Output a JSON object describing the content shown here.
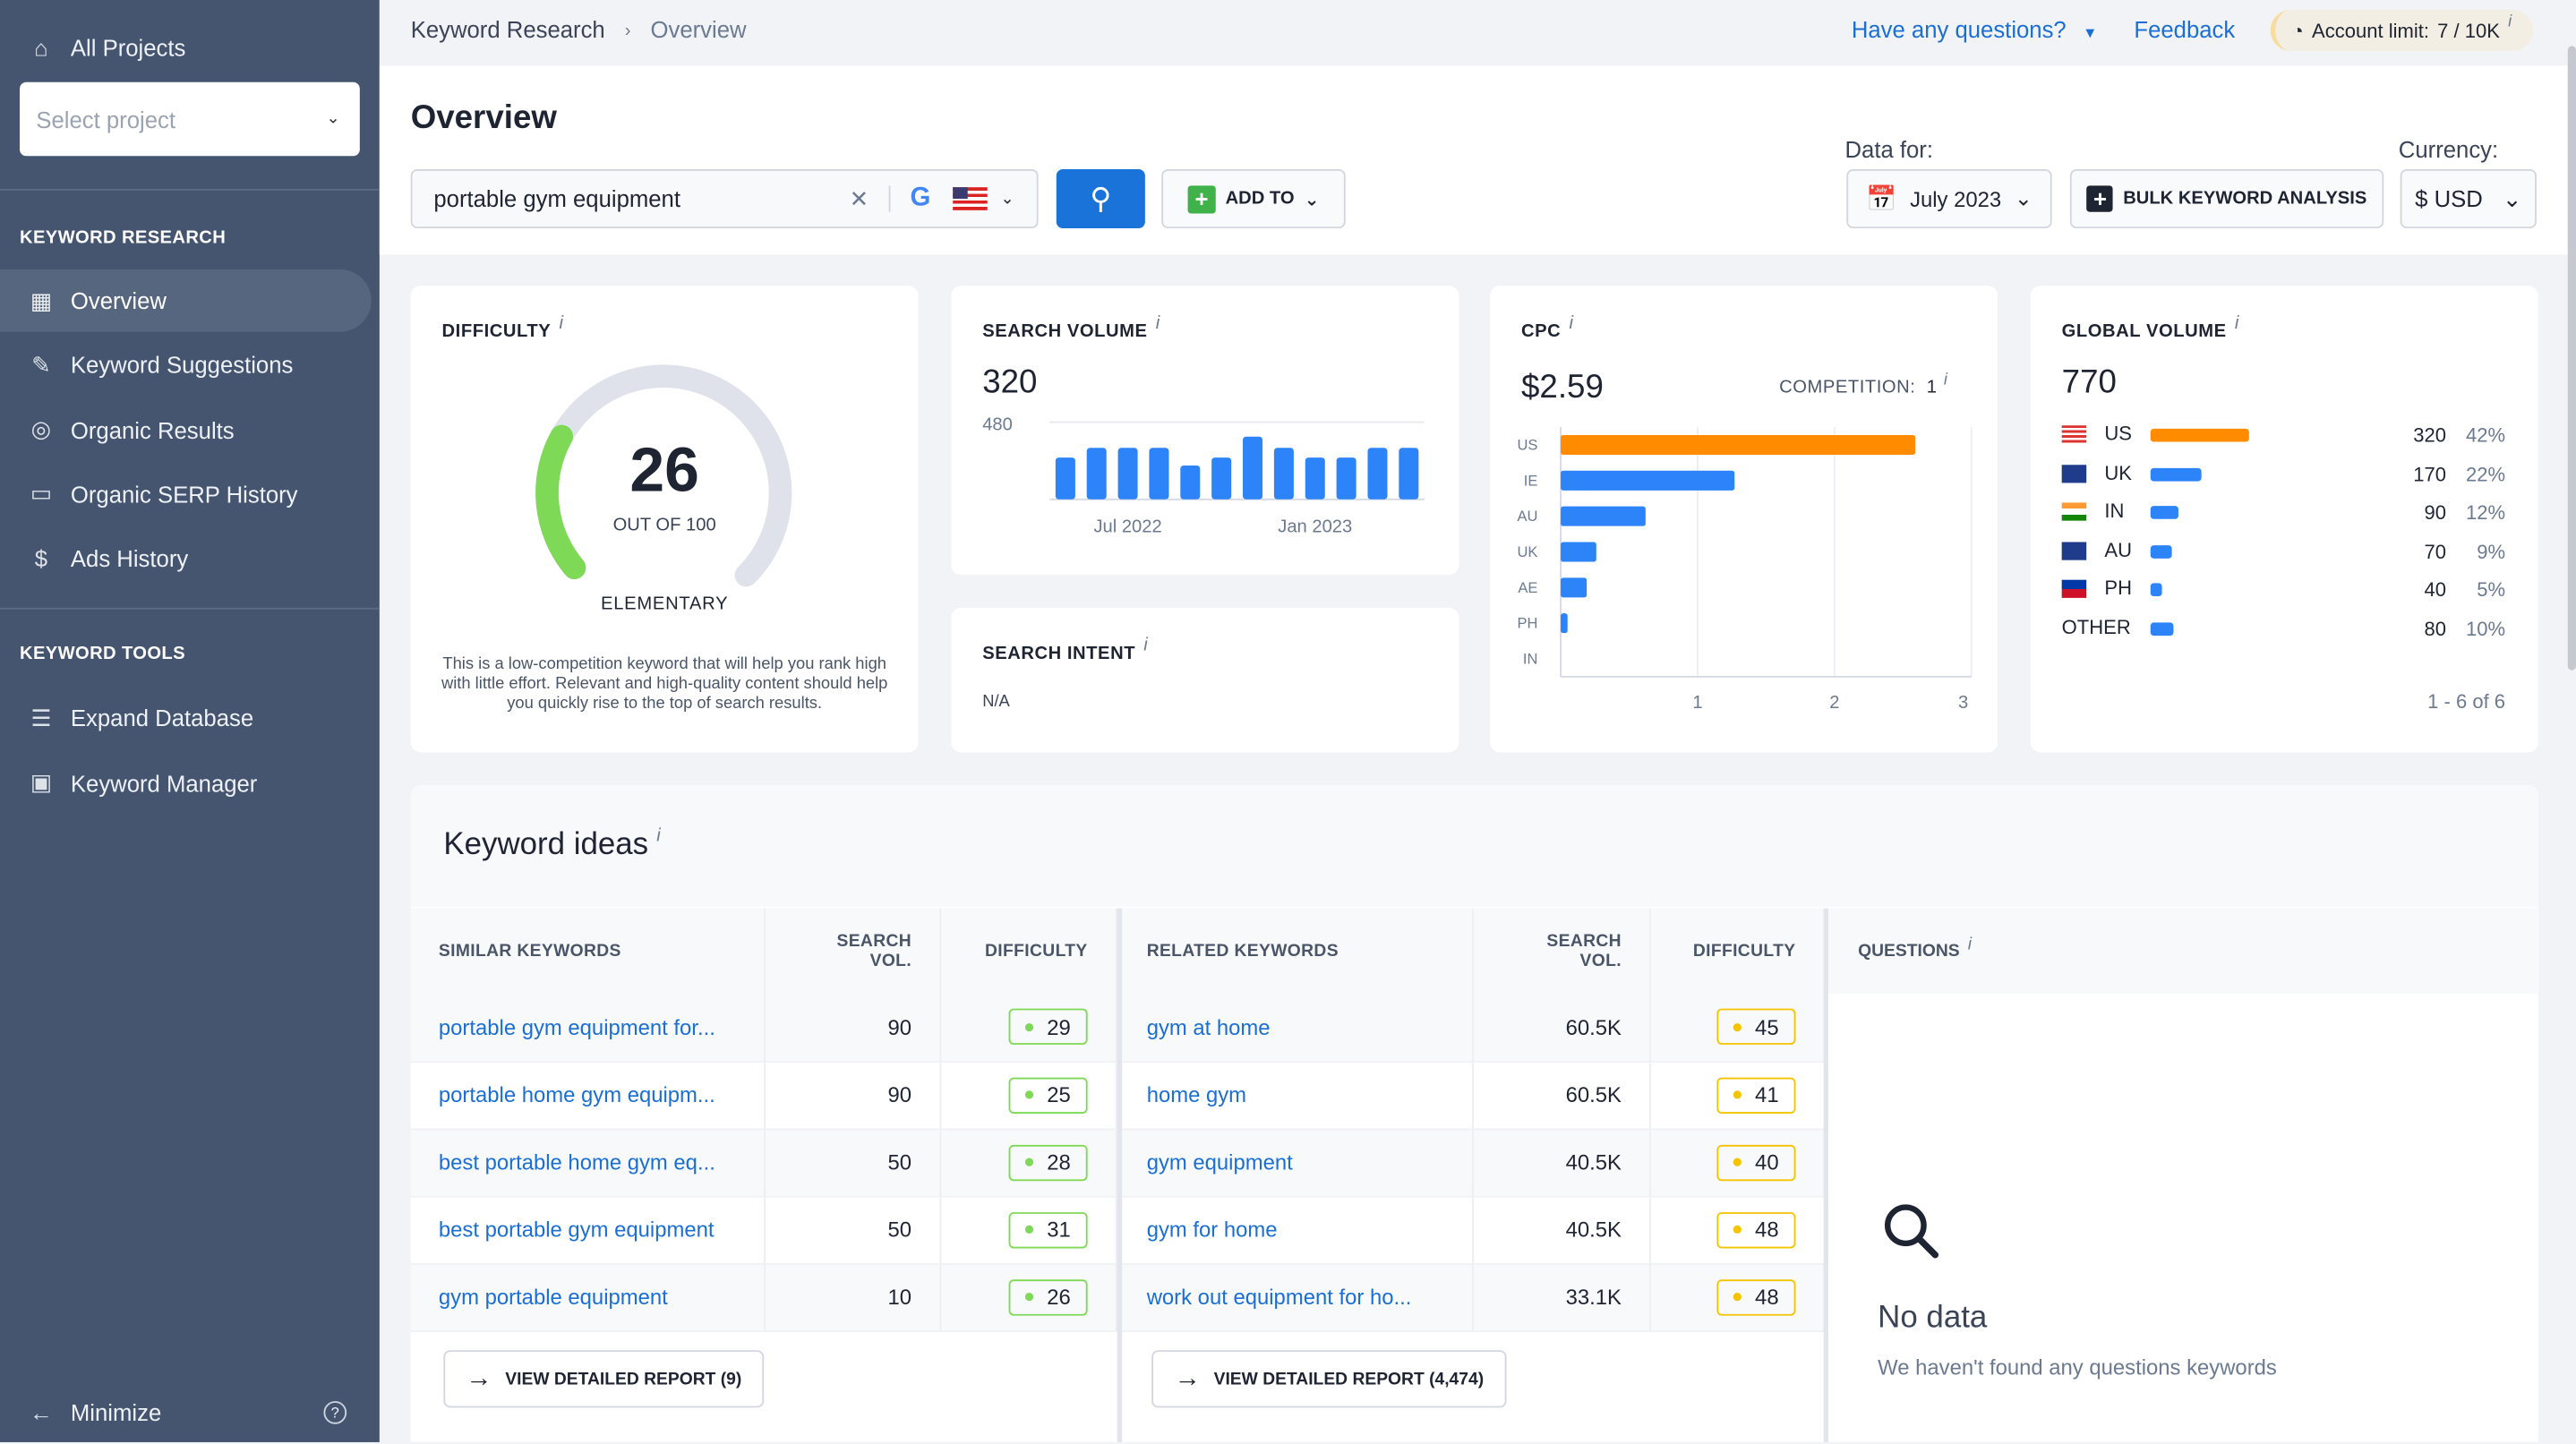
{
  "sidebar": {
    "all_projects": "All Projects",
    "select_project_placeholder": "Select project",
    "section_research": "KEYWORD RESEARCH",
    "research_items": [
      {
        "label": "Overview",
        "icon": "grid-icon",
        "active": true
      },
      {
        "label": "Keyword Suggestions",
        "icon": "pencil-icon"
      },
      {
        "label": "Organic Results",
        "icon": "target-icon"
      },
      {
        "label": "Organic SERP History",
        "icon": "archive-icon"
      },
      {
        "label": "Ads History",
        "icon": "dollar-icon"
      }
    ],
    "section_tools": "KEYWORD TOOLS",
    "tool_items": [
      {
        "label": "Expand Database",
        "icon": "database-icon"
      },
      {
        "label": "Keyword Manager",
        "icon": "briefcase-icon"
      }
    ],
    "minimize": "Minimize"
  },
  "topbar": {
    "breadcrumb": [
      "Keyword Research",
      "Overview"
    ],
    "questions": "Have any questions?",
    "feedback": "Feedback",
    "account_limit_label": "Account limit:",
    "account_limit_value": "7 / 10K"
  },
  "header": {
    "title": "Overview",
    "search_value": "portable gym equipment",
    "add_to": "ADD TO",
    "data_for_label": "Data for:",
    "data_for_value": "July 2023",
    "bulk": "BULK KEYWORD ANALYSIS",
    "currency_label": "Currency:",
    "currency_value": "$ USD"
  },
  "difficulty": {
    "title": "DIFFICULTY",
    "value": "26",
    "max": 100,
    "out_of": "OUT OF 100",
    "level": "ELEMENTARY",
    "description": "This is a low-competition keyword that will help you rank high with little effort. Relevant and high-quality content should help you quickly rise to the top of search results.",
    "colors": {
      "fill": "#7ed957",
      "track": "#dfe2ea"
    }
  },
  "search_volume": {
    "title": "SEARCH VOLUME",
    "value": "320"
  },
  "search_intent": {
    "title": "SEARCH INTENT",
    "value": "N/A"
  },
  "cpc": {
    "title": "CPC",
    "value": "$2.59",
    "competition_label": "COMPETITION:",
    "competition_value": "1"
  },
  "global_volume": {
    "title": "GLOBAL VOLUME",
    "value": "770",
    "rows": [
      {
        "country": "US",
        "volume": "320",
        "pct": "42%",
        "share": 42,
        "flag": "us-flag-icon",
        "color": "#ff8c00"
      },
      {
        "country": "UK",
        "volume": "170",
        "pct": "22%",
        "share": 22,
        "flag": "uk-flag-icon",
        "color": "#2d84f8"
      },
      {
        "country": "IN",
        "volume": "90",
        "pct": "12%",
        "share": 12,
        "flag": "in-flag-icon",
        "color": "#2d84f8"
      },
      {
        "country": "AU",
        "volume": "70",
        "pct": "9%",
        "share": 9,
        "flag": "au-flag-icon",
        "color": "#2d84f8"
      },
      {
        "country": "PH",
        "volume": "40",
        "pct": "5%",
        "share": 5,
        "flag": "ph-flag-icon",
        "color": "#2d84f8"
      },
      {
        "country": "OTHER",
        "volume": "80",
        "pct": "10%",
        "share": 10,
        "flag": "",
        "color": "#2d84f8"
      }
    ],
    "pagination": "1 - 6 of 6"
  },
  "chart_data": [
    {
      "type": "bar",
      "ylim": [
        0,
        480
      ],
      "ytick_label": "480",
      "values": [
        260,
        320,
        320,
        320,
        210,
        260,
        390,
        320,
        260,
        260,
        320,
        320
      ],
      "xtick_labels": [
        {
          "index": 2,
          "label": "Jul 2022"
        },
        {
          "index": 8,
          "label": "Jan 2023"
        }
      ],
      "color": "#2d84f8"
    },
    {
      "type": "bar",
      "orientation": "horizontal",
      "categories": [
        "US",
        "IE",
        "AU",
        "UK",
        "AE",
        "PH",
        "IN"
      ],
      "values": [
        2.59,
        1.27,
        0.62,
        0.26,
        0.19,
        0.05,
        0
      ],
      "xlim": [
        0,
        3
      ],
      "xticks": [
        "1",
        "2",
        "3"
      ],
      "colors": {
        "highlight": "#ff8c00",
        "default": "#2d84f8"
      }
    }
  ],
  "keyword_ideas": {
    "title": "Keyword ideas",
    "similar": {
      "headers": [
        "SIMILAR KEYWORDS",
        "SEARCH VOL.",
        "DIFFICULTY"
      ],
      "rows": [
        [
          "portable gym equipment for...",
          "90",
          "29"
        ],
        [
          "portable home gym equipm...",
          "90",
          "25"
        ],
        [
          "best portable home gym eq...",
          "50",
          "28"
        ],
        [
          "best portable gym equipment",
          "50",
          "31"
        ],
        [
          "gym portable equipment",
          "10",
          "26"
        ]
      ],
      "badge_color": "#7ed957",
      "report": "VIEW DETAILED REPORT (9)"
    },
    "related": {
      "headers": [
        "RELATED KEYWORDS",
        "SEARCH VOL.",
        "DIFFICULTY"
      ],
      "rows": [
        [
          "gym at home",
          "60.5K",
          "45"
        ],
        [
          "home gym",
          "60.5K",
          "41"
        ],
        [
          "gym equipment",
          "40.5K",
          "40"
        ],
        [
          "gym for home",
          "40.5K",
          "48"
        ],
        [
          "work out equipment for ho...",
          "33.1K",
          "48"
        ]
      ],
      "badge_color": "#f5c400",
      "report": "VIEW DETAILED REPORT (4,474)"
    },
    "questions": {
      "header": "QUESTIONS",
      "empty_title": "No data",
      "empty_text": "We haven't found any questions keywords"
    }
  }
}
